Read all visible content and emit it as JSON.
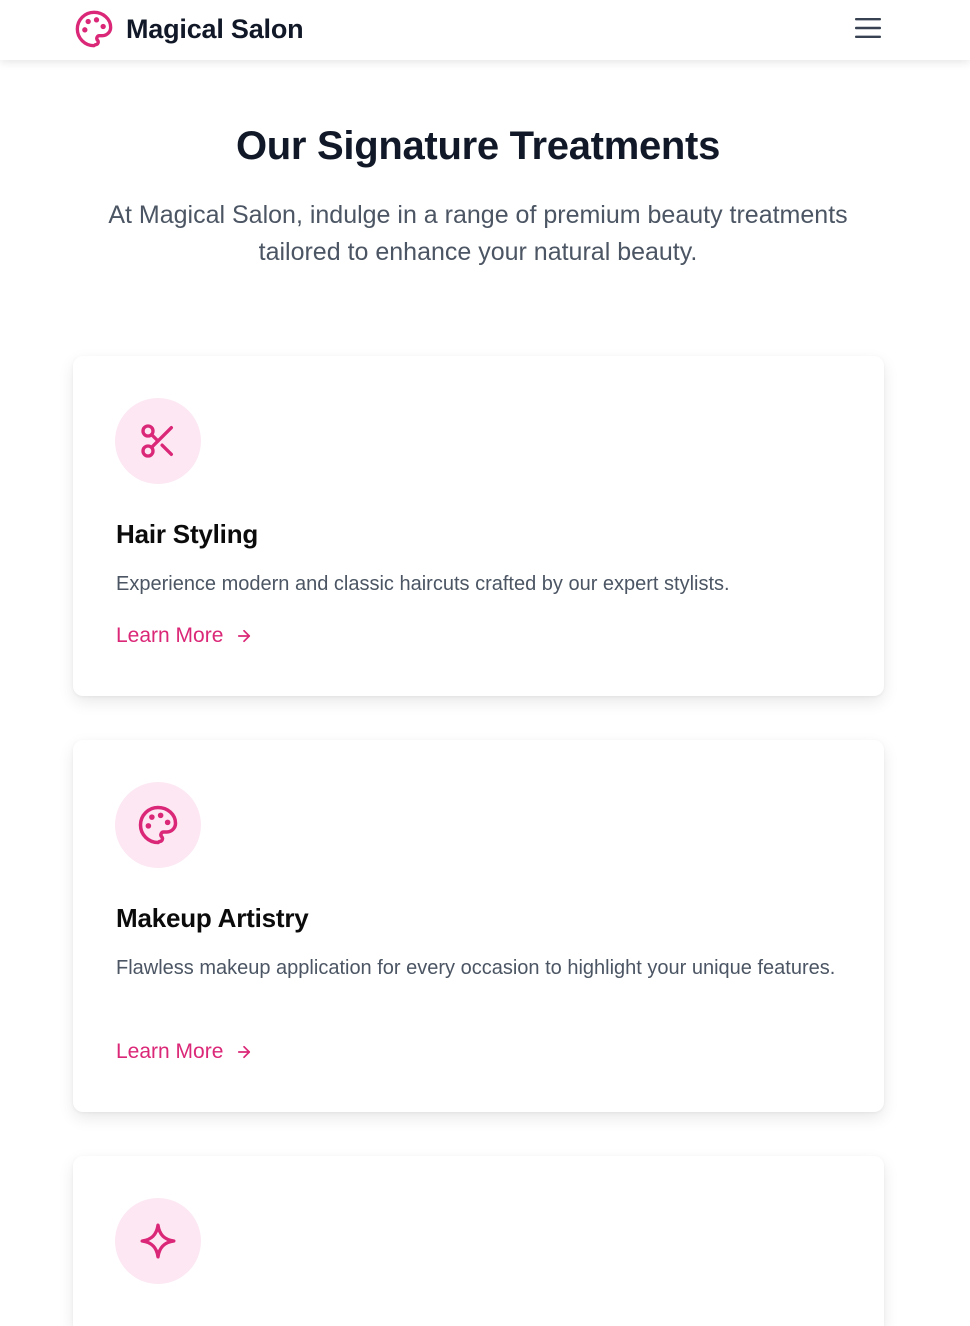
{
  "app": {
    "brand_name": "Magical Salon",
    "brand_icon": "palette-icon",
    "menu_icon": "hamburger-menu-icon"
  },
  "colors": {
    "accent": "#db2777",
    "icon_bg": "#fce7f3",
    "heading": "#111827",
    "body_text": "#4b5563"
  },
  "hero": {
    "title": "Our Signature Treatments",
    "subtitle": "At Magical Salon, indulge in a range of premium beauty treatments tailored to enhance your natural beauty."
  },
  "treatments": [
    {
      "icon": "scissors-icon",
      "title": "Hair Styling",
      "description": "Experience modern and classic haircuts crafted by our expert stylists.",
      "link_label": "Learn More"
    },
    {
      "icon": "palette-icon",
      "title": "Makeup Artistry",
      "description": "Flawless makeup application for every occasion to highlight your unique features.",
      "link_label": "Learn More"
    },
    {
      "icon": "sparkle-icon"
    }
  ]
}
